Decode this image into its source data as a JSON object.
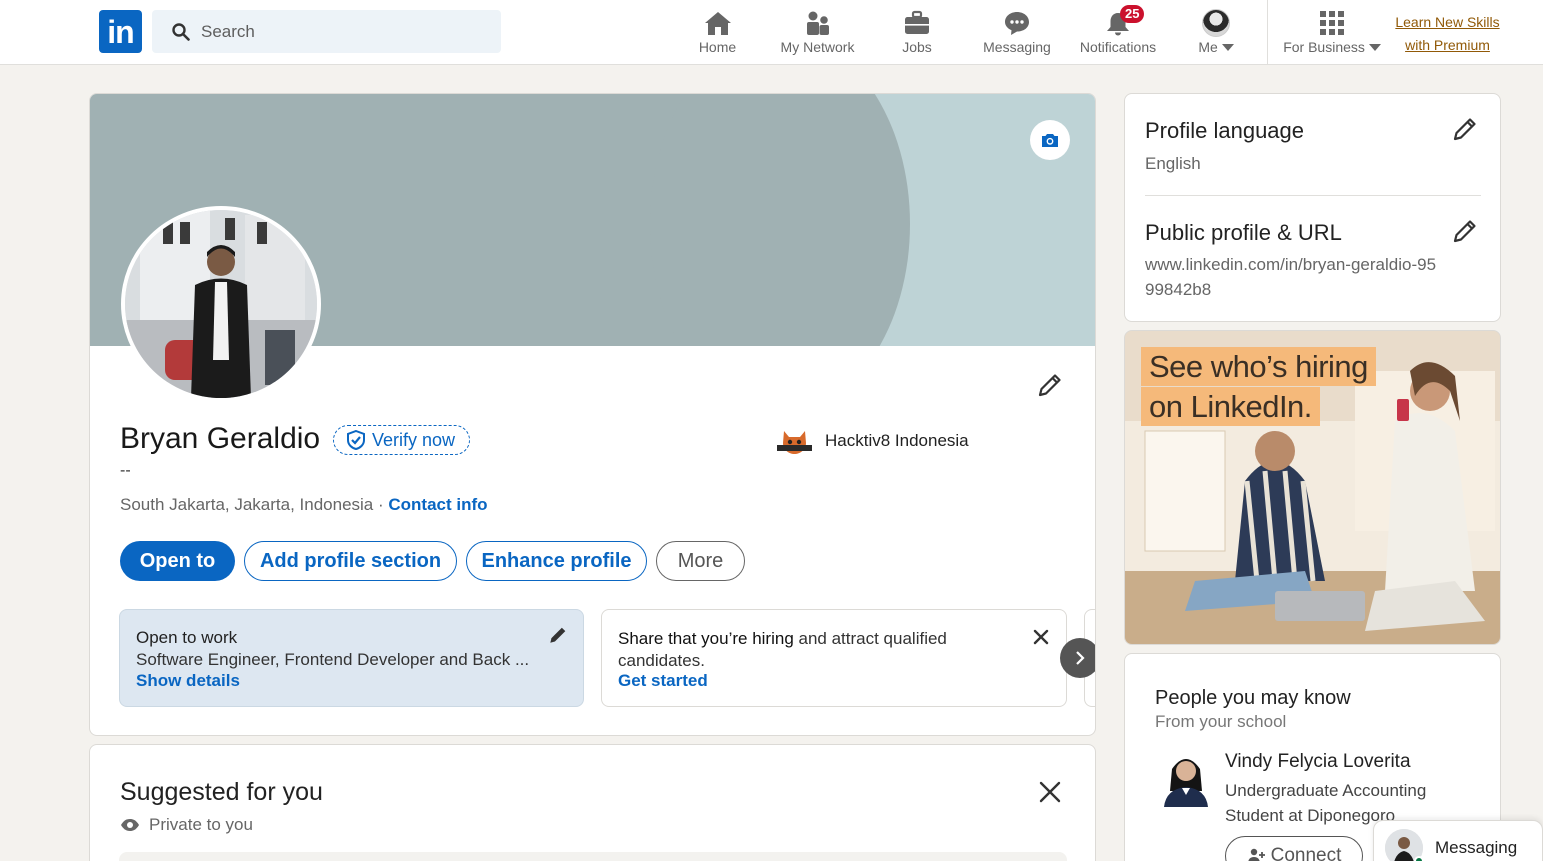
{
  "nav": {
    "logo_text": "in",
    "search_placeholder": "Search",
    "items": [
      {
        "label": "Home"
      },
      {
        "label": "My Network"
      },
      {
        "label": "Jobs"
      },
      {
        "label": "Messaging"
      },
      {
        "label": "Notifications",
        "badge": "25"
      },
      {
        "label": "Me"
      },
      {
        "label": "For Business"
      }
    ],
    "premium_line1": "Learn New Skills",
    "premium_line2": "with Premium"
  },
  "profile": {
    "name": "Bryan Geraldio",
    "verify_label": "Verify now",
    "headline": "--",
    "location": "South Jakarta, Jakarta, Indonesia",
    "separator": " · ",
    "contact_info": "Contact info",
    "company": "Hacktiv8 Indonesia",
    "buttons": {
      "open_to": "Open to",
      "add_section": "Add profile section",
      "enhance": "Enhance profile",
      "more": "More"
    },
    "open_to_work": {
      "title": "Open to work",
      "roles": "Software Engineer, Frontend Developer and Back ...",
      "link": "Show details"
    },
    "hiring": {
      "bold": "Share that you’re hiring",
      "rest": " and attract qualified candidates.",
      "link": "Get started"
    }
  },
  "suggested": {
    "title": "Suggested for you",
    "subtitle": "Private to you"
  },
  "sidebar": {
    "profile_language_title": "Profile language",
    "profile_language_value": "English",
    "public_profile_title": "Public profile & URL",
    "public_profile_url": "www.linkedin.com/in/bryan-geraldio-9599842b8",
    "ad_line1": "See who’s hiring",
    "ad_line2": "on LinkedIn.",
    "pymk_title": "People you may know",
    "pymk_subtitle": "From your school",
    "person_name": "Vindy Felycia Loverita",
    "person_desc": "Undergraduate Accounting Student at Diponegoro",
    "connect_label": "Connect"
  },
  "messaging": {
    "label": "Messaging"
  },
  "colors": {
    "brand": "#0a66c2",
    "badge": "#cb112d",
    "premium": "#915907",
    "banner": "#a0b1b3"
  }
}
